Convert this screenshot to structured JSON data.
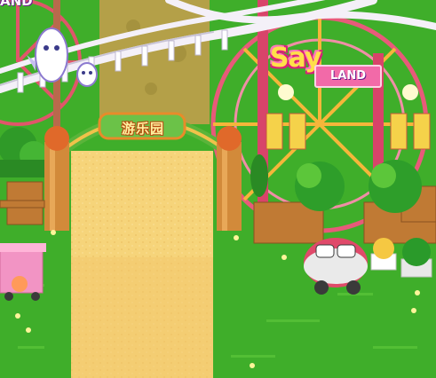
{
  "scene": {
    "arch_sign_text": "游乐园",
    "park_sign_top": "Say",
    "park_sign_bottom": "LAND",
    "corner_sign_fragment": "AND"
  },
  "palette": {
    "grass": "#3fae2a",
    "path": "#f6d47a",
    "track": "#f4f0f8",
    "ferris": "#e0566a",
    "pole": "#c8783a"
  }
}
